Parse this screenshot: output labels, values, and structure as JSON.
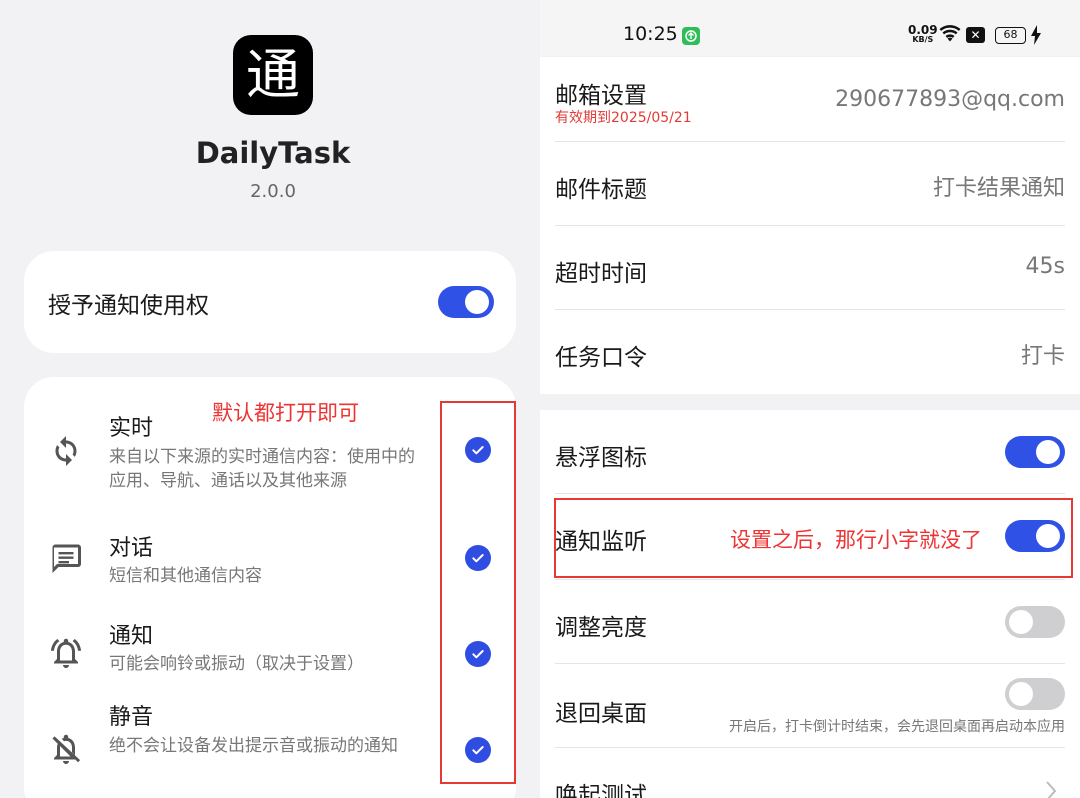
{
  "left": {
    "app_icon_glyph": "通",
    "app_name": "DailyTask",
    "version": "2.0.0",
    "permission_label": "授予通知使用权",
    "permission_enabled": true,
    "annotation": "默认都打开即可",
    "types": [
      {
        "icon": "sync-icon",
        "title": "实时",
        "desc": "来自以下来源的实时通信内容：使用中的应用、导航、通话以及其他来源",
        "checked": true
      },
      {
        "icon": "message-icon",
        "title": "对话",
        "desc": "短信和其他通信内容",
        "checked": true
      },
      {
        "icon": "bell-ring-icon",
        "title": "通知",
        "desc": "可能会响铃或振动（取决于设置）",
        "checked": true
      },
      {
        "icon": "bell-off-icon",
        "title": "静音",
        "desc": "绝不会让设备发出提示音或振动的通知",
        "checked": true
      }
    ]
  },
  "status_bar": {
    "time": "10:25",
    "speed_value": "0.09",
    "speed_unit": "KB/S",
    "battery": "68"
  },
  "settings": {
    "email_label": "邮箱设置",
    "email_expiry": "有效期到2025/05/21",
    "email_value": "290677893@qq.com",
    "subject_label": "邮件标题",
    "subject_value": "打卡结果通知",
    "timeout_label": "超时时间",
    "timeout_value": "45s",
    "command_label": "任务口令",
    "command_value": "打卡",
    "float_icon_label": "悬浮图标",
    "float_icon_enabled": true,
    "notify_listen_label": "通知监听",
    "notify_listen_enabled": true,
    "notify_annotation": "设置之后，那行小字就没了",
    "brightness_label": "调整亮度",
    "brightness_enabled": false,
    "return_desktop_label": "退回桌面",
    "return_desktop_enabled": false,
    "return_desktop_hint": "开启后，打卡倒计时结束，会先退回桌面再启动本应用",
    "wake_test_label": "唤起测试"
  },
  "colors": {
    "accent": "#3051e6",
    "annotation_red": "#e53935",
    "toggle_off": "#cfcfd2"
  }
}
